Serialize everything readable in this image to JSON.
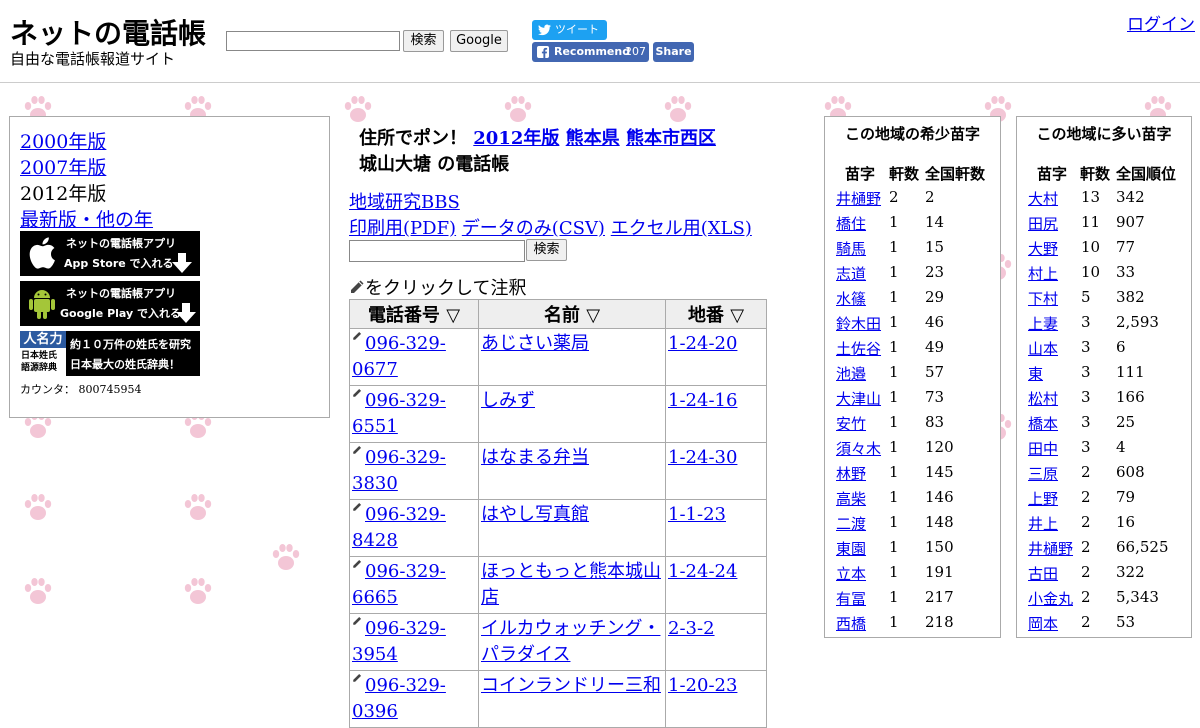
{
  "header": {
    "site_title": "ネットの電話帳",
    "site_subtitle": "自由な電話帳報道サイト",
    "search_button": "検索",
    "google_button": "Google",
    "tweet_label": "ツイート",
    "fb_recommend_label": "Recommend",
    "fb_recommend_count": "207",
    "fb_share_label": "Share",
    "login_label": "ログイン"
  },
  "left": {
    "years": [
      "2000年版",
      "2007年版",
      "2012年版",
      "最新版・他の年"
    ],
    "app_store_line1": "ネットの電話帳アプリ",
    "app_store_line2": "App Store で入れる",
    "google_play_line1": "ネットの電話帳アプリ",
    "google_play_line2": "Google Play で入れる",
    "jinmei_logo_top": "人名力",
    "jinmei_logo_line1": "日本姓氏",
    "jinmei_logo_line2": "語源辞典",
    "jinmei_text1": "約１０万件の姓氏を研究",
    "jinmei_text2": "日本最大の姓氏辞典！",
    "counter_label": "カウンタ：",
    "counter_value": "800745954"
  },
  "center": {
    "title_prefix": "住所でポン！",
    "title_year": "2012年版",
    "title_pref": "熊本県",
    "title_city": "熊本市西区",
    "title_area": "城山大塘",
    "title_suffix": "の電話帳",
    "bbs_link": "地域研究BBS",
    "pdf_link": "印刷用(PDF)",
    "csv_link": "データのみ(CSV)",
    "xls_link": "エクセル用(XLS)",
    "search_button": "検索",
    "annotation_note": "をクリックして注釈",
    "table_headers": [
      "電話番号 ▽",
      "名前 ▽",
      "地番 ▽"
    ],
    "rows": [
      {
        "phone": "096-329-0677",
        "name": "あじさい薬局",
        "chiban": "1-24-20"
      },
      {
        "phone": "096-329-6551",
        "name": "しみず",
        "chiban": "1-24-16"
      },
      {
        "phone": "096-329-3830",
        "name": "はなまる弁当",
        "chiban": "1-24-30"
      },
      {
        "phone": "096-329-8428",
        "name": "はやし写真館",
        "chiban": "1-1-23"
      },
      {
        "phone": "096-329-6665",
        "name": "ほっともっと熊本城山店",
        "chiban": "1-24-24"
      },
      {
        "phone": "096-329-3954",
        "name": "イルカウォッチング・パラダイス",
        "chiban": "2-3-2"
      },
      {
        "phone": "096-329-0396",
        "name": "コインランドリー三和",
        "chiban": "1-20-23"
      }
    ]
  },
  "rare": {
    "title": "この地域の希少苗字",
    "headers": [
      "苗字",
      "軒数",
      "全国軒数"
    ],
    "rows": [
      {
        "name": "井樋野",
        "count": "2",
        "national": "2"
      },
      {
        "name": "橋住",
        "count": "1",
        "national": "14"
      },
      {
        "name": "騎馬",
        "count": "1",
        "national": "15"
      },
      {
        "name": "志道",
        "count": "1",
        "national": "23"
      },
      {
        "name": "水篠",
        "count": "1",
        "national": "29"
      },
      {
        "name": "鈴木田",
        "count": "1",
        "national": "46"
      },
      {
        "name": "土佐谷",
        "count": "1",
        "national": "49"
      },
      {
        "name": "池邉",
        "count": "1",
        "national": "57"
      },
      {
        "name": "大津山",
        "count": "1",
        "national": "73"
      },
      {
        "name": "安竹",
        "count": "1",
        "national": "83"
      },
      {
        "name": "須々木",
        "count": "1",
        "national": "120"
      },
      {
        "name": "林野",
        "count": "1",
        "national": "145"
      },
      {
        "name": "高柴",
        "count": "1",
        "national": "146"
      },
      {
        "name": "二渡",
        "count": "1",
        "national": "148"
      },
      {
        "name": "東園",
        "count": "1",
        "national": "150"
      },
      {
        "name": "立本",
        "count": "1",
        "national": "191"
      },
      {
        "name": "有冨",
        "count": "1",
        "national": "217"
      },
      {
        "name": "西橋",
        "count": "1",
        "national": "218"
      }
    ]
  },
  "many": {
    "title": "この地域に多い苗字",
    "headers": [
      "苗字",
      "軒数",
      "全国順位"
    ],
    "rows": [
      {
        "name": "大村",
        "count": "13",
        "rank": "342"
      },
      {
        "name": "田尻",
        "count": "11",
        "rank": "907"
      },
      {
        "name": "大野",
        "count": "10",
        "rank": "77"
      },
      {
        "name": "村上",
        "count": "10",
        "rank": "33"
      },
      {
        "name": "下村",
        "count": "5",
        "rank": "382"
      },
      {
        "name": "上妻",
        "count": "3",
        "rank": "2,593"
      },
      {
        "name": "山本",
        "count": "3",
        "rank": "6"
      },
      {
        "name": "東",
        "count": "3",
        "rank": "111"
      },
      {
        "name": "松村",
        "count": "3",
        "rank": "166"
      },
      {
        "name": "橋本",
        "count": "3",
        "rank": "25"
      },
      {
        "name": "田中",
        "count": "3",
        "rank": "4"
      },
      {
        "name": "三原",
        "count": "2",
        "rank": "608"
      },
      {
        "name": "上野",
        "count": "2",
        "rank": "79"
      },
      {
        "name": "井上",
        "count": "2",
        "rank": "16"
      },
      {
        "name": "井樋野",
        "count": "2",
        "rank": "66,525"
      },
      {
        "name": "古田",
        "count": "2",
        "rank": "322"
      },
      {
        "name": "小金丸",
        "count": "2",
        "rank": "5,343"
      },
      {
        "name": "岡本",
        "count": "2",
        "rank": "53"
      }
    ]
  },
  "icons": {
    "paw": "paw-icon",
    "pencil": "pencil-icon",
    "apple": "apple-icon",
    "android": "android-icon",
    "twitter": "twitter-bird-icon",
    "facebook": "facebook-icon"
  },
  "colors": {
    "paw": "#f3c6d6",
    "link": "#0000ee",
    "twitter": "#1da1f2",
    "facebook": "#4267b2"
  }
}
